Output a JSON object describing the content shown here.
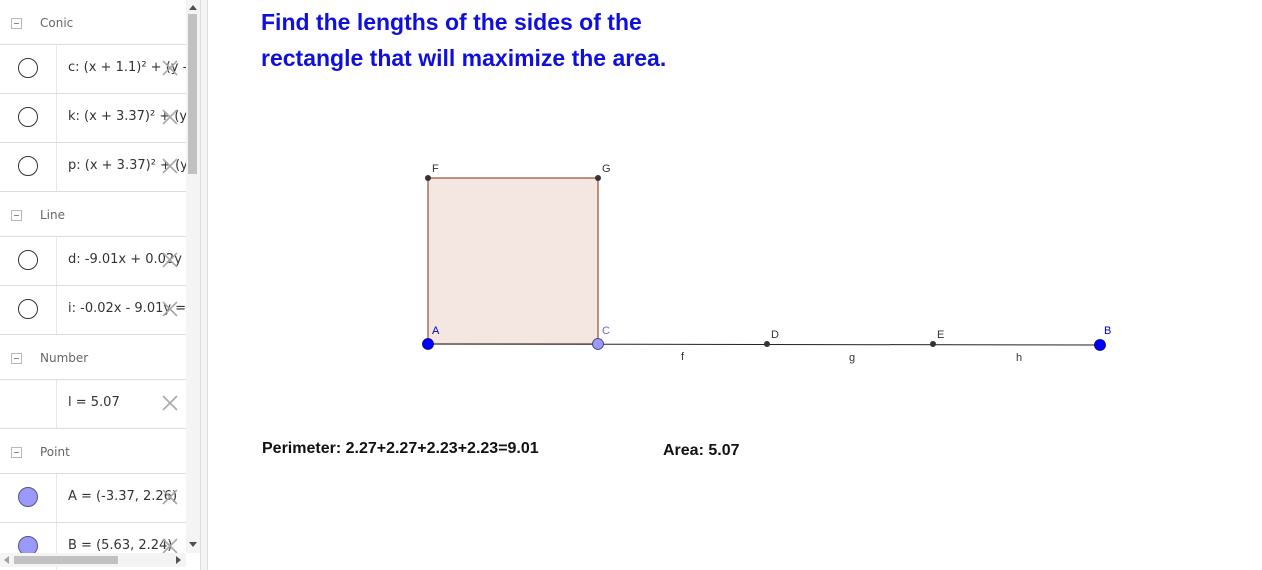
{
  "algebra": {
    "groups": [
      {
        "label": "Conic",
        "items": [
          {
            "def": "c: (x + 1.1)² + (y -",
            "marble": "outline"
          },
          {
            "def": "k: (x + 3.37)² + (y",
            "marble": "outline"
          },
          {
            "def": "p: (x + 3.37)² + (y",
            "marble": "outline"
          }
        ]
      },
      {
        "label": "Line",
        "items": [
          {
            "def": "d: -9.01x + 0.02y =",
            "marble": "outline"
          },
          {
            "def": "i: -0.02x - 9.01y = -",
            "marble": "outline"
          }
        ]
      },
      {
        "label": "Number",
        "items": [
          {
            "def": "l = 5.07",
            "marble": "none"
          }
        ]
      },
      {
        "label": "Point",
        "items": [
          {
            "def": "A = (-3.37, 2.26)",
            "marble": "filled"
          },
          {
            "def": "B = (5.63, 2.24)",
            "marble": "filled"
          }
        ]
      }
    ]
  },
  "graphics": {
    "task_line1": "Find the lengths of the sides of the",
    "task_line2": "rectangle that will maximize the area.",
    "perimeter_text": "Perimeter: 2.27+2.27+2.23+2.23=9.01",
    "area_text": "Area: 5.07",
    "points": {
      "A": "A",
      "B": "B",
      "C": "C",
      "D": "D",
      "E": "E",
      "F": "F",
      "G": "G"
    },
    "segments": {
      "f": "f",
      "g": "g",
      "h": "h"
    }
  },
  "colors": {
    "task_text": "#1010dd",
    "free_point": "#0000ff",
    "point_on_path": "#9999ff",
    "rectangle_fill": "#f4e6e0",
    "rectangle_stroke": "#994d33"
  }
}
